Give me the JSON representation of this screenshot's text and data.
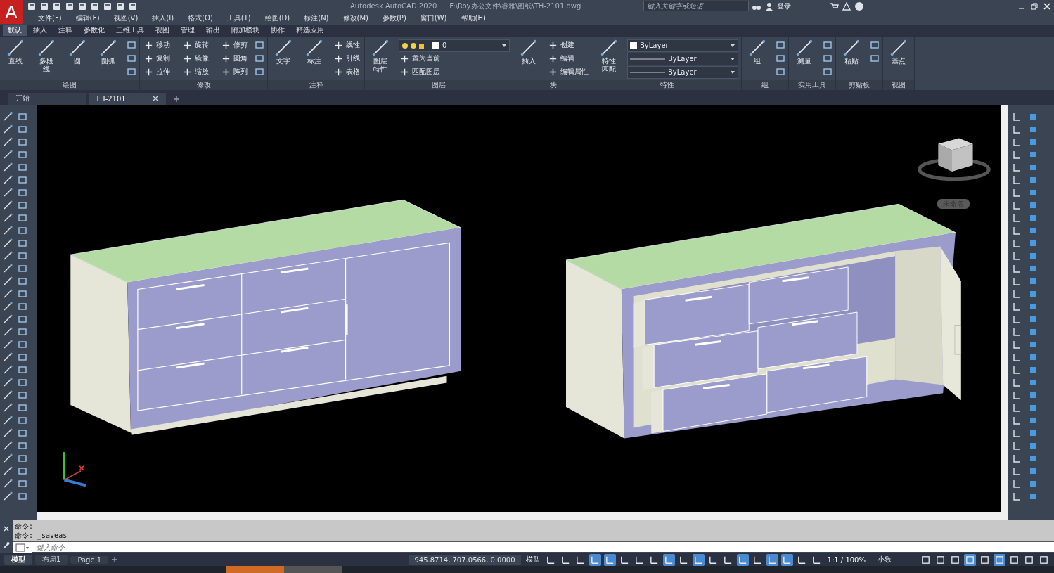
{
  "title_bar": {
    "logo": "A",
    "title": "Autodesk AutoCAD 2020",
    "file_path": "F:\\Roy办公文件\\睿雅\\图纸\\TH-2101.dwg",
    "search_placeholder": "键入关键字或短语",
    "user": "登录"
  },
  "menu": [
    "文件(F)",
    "编辑(E)",
    "视图(V)",
    "插入(I)",
    "格式(O)",
    "工具(T)",
    "绘图(D)",
    "标注(N)",
    "修改(M)",
    "参数(P)",
    "窗口(W)",
    "帮助(H)"
  ],
  "ribbon_tabs": [
    {
      "label": "默认",
      "selected": true
    },
    {
      "label": "插入",
      "selected": false
    },
    {
      "label": "注释",
      "selected": false
    },
    {
      "label": "参数化",
      "selected": false
    },
    {
      "label": "三维工具",
      "selected": false
    },
    {
      "label": "视图",
      "selected": false
    },
    {
      "label": "管理",
      "selected": false
    },
    {
      "label": "输出",
      "selected": false
    },
    {
      "label": "附加模块",
      "selected": false
    },
    {
      "label": "协作",
      "selected": false
    },
    {
      "label": "精选应用",
      "selected": false
    }
  ],
  "ribbon_panels": [
    {
      "title": "绘图",
      "large": [
        "直线",
        "多段线",
        "圆",
        "圆弧"
      ]
    },
    {
      "title": "修改",
      "small": [
        "移动",
        "复制",
        "拉伸",
        "旋转",
        "镜像",
        "缩放",
        "修剪",
        "圆角",
        "阵列"
      ]
    },
    {
      "title": "注释",
      "large": [
        "文字",
        "标注"
      ],
      "small": [
        "线性",
        "引线",
        "表格"
      ]
    },
    {
      "title": "图层",
      "large": [
        "图层特性"
      ],
      "dropdowns": [
        {
          "kind": "layer",
          "value": "0"
        }
      ],
      "small": [
        "置为当前",
        "匹配图层"
      ]
    },
    {
      "title": "块",
      "large": [
        "插入"
      ],
      "small": [
        "创建",
        "编辑",
        "编辑属性"
      ]
    },
    {
      "title": "特性",
      "large": [
        "特性匹配"
      ],
      "dropdowns": [
        {
          "kind": "color",
          "value": "ByLayer"
        },
        {
          "kind": "line",
          "value": "ByLayer"
        },
        {
          "kind": "line",
          "value": "ByLayer"
        }
      ]
    },
    {
      "title": "组",
      "large": [
        "组"
      ]
    },
    {
      "title": "实用工具",
      "large": [
        "测量"
      ]
    },
    {
      "title": "剪贴板",
      "large": [
        "粘贴"
      ]
    },
    {
      "title": "视图",
      "large": [
        "基点"
      ]
    }
  ],
  "file_tabs": [
    {
      "label": "开始",
      "selected": false,
      "closable": false
    },
    {
      "label": "TH-2101",
      "selected": true,
      "closable": true
    }
  ],
  "viewport": {
    "ucs_label": "未命名"
  },
  "command": {
    "history": [
      "命令:",
      "命令:  _saveas"
    ],
    "placeholder": "键入命令"
  },
  "status_bar": {
    "layout_tabs": [
      {
        "label": "模型",
        "selected": true
      },
      {
        "label": "布局1",
        "selected": false
      },
      {
        "label": "Page 1",
        "selected": false
      }
    ],
    "coordinates": "945.8714, 707.0566, 0.0000",
    "space": "模型",
    "scale": "1:1 / 100%",
    "units": "小数",
    "toggles": [
      {
        "on": false
      },
      {
        "on": false
      },
      {
        "on": false
      },
      {
        "on": true
      },
      {
        "on": true
      },
      {
        "on": false
      },
      {
        "on": false
      },
      {
        "on": false
      },
      {
        "on": true
      },
      {
        "on": false
      },
      {
        "on": true
      },
      {
        "on": false
      },
      {
        "on": false
      },
      {
        "on": true
      },
      {
        "on": false
      },
      {
        "on": true
      },
      {
        "on": true
      },
      {
        "on": false
      },
      {
        "on": false
      }
    ],
    "tail_toggles": [
      {
        "on": false
      },
      {
        "on": false
      },
      {
        "on": false
      },
      {
        "on": true
      },
      {
        "on": false
      },
      {
        "on": true
      },
      {
        "on": false
      },
      {
        "on": false
      },
      {
        "on": false
      }
    ]
  }
}
